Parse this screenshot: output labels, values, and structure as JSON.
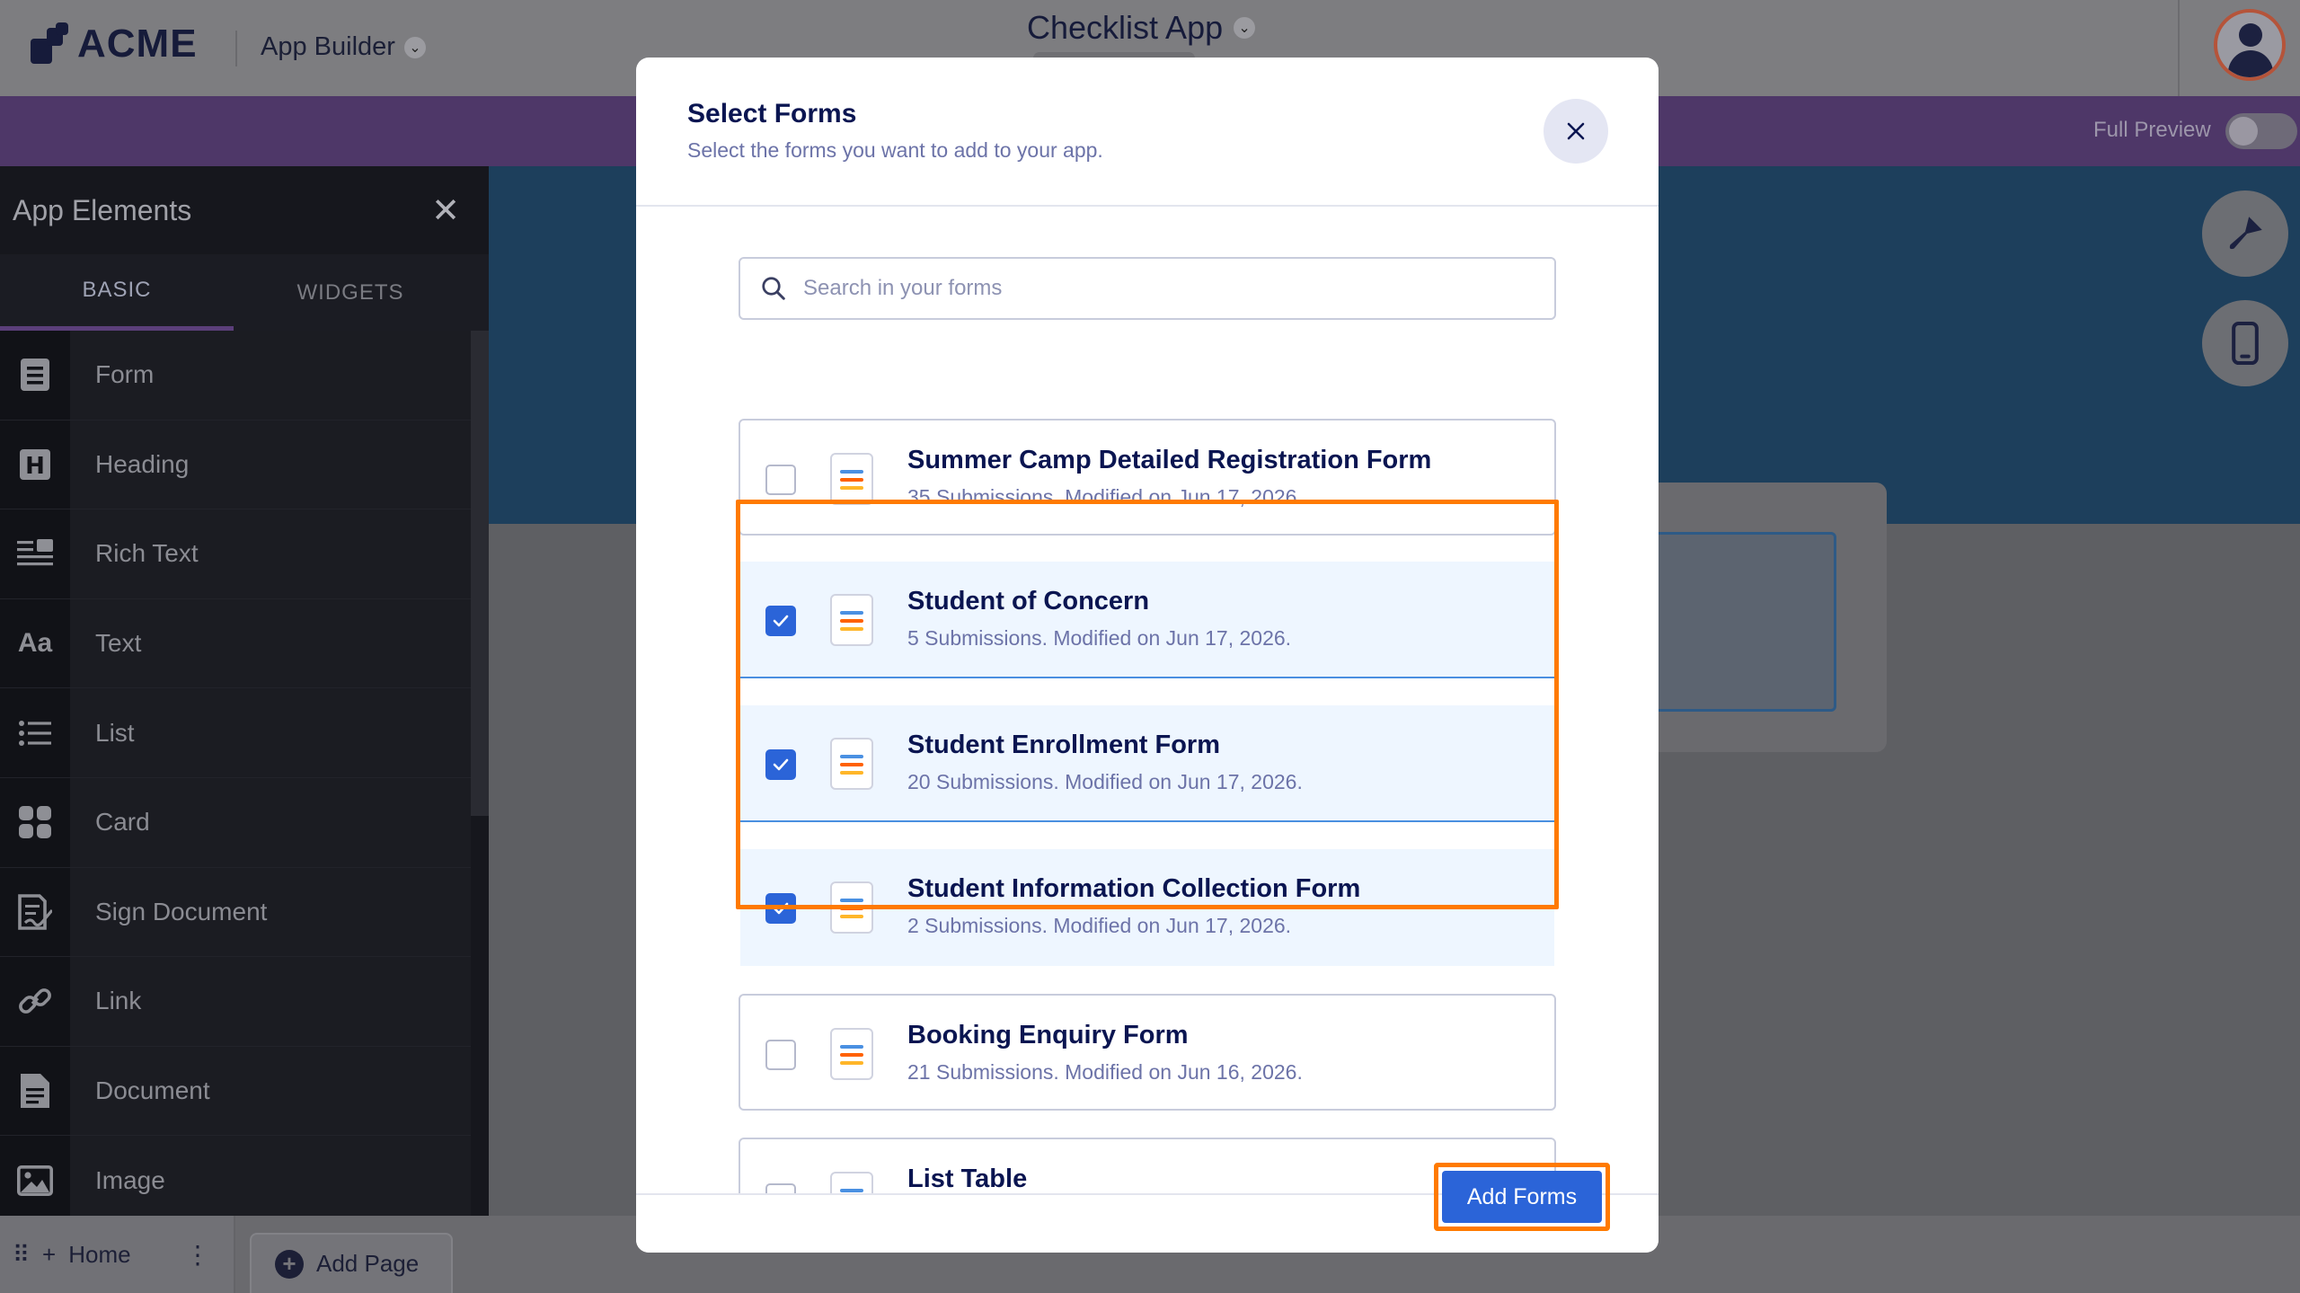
{
  "topbar": {
    "logo_text": "ACME",
    "app_builder_label": "App Builder",
    "app_title": "Checklist App"
  },
  "preview": {
    "full_preview_label": "Full Preview"
  },
  "sidebar": {
    "title": "App Elements",
    "tabs": [
      {
        "label": "BASIC",
        "active": true
      },
      {
        "label": "WIDGETS",
        "active": false
      }
    ],
    "items": [
      {
        "label": "Form",
        "icon": "form-icon"
      },
      {
        "label": "Heading",
        "icon": "heading-icon"
      },
      {
        "label": "Rich Text",
        "icon": "rich-text-icon"
      },
      {
        "label": "Text",
        "icon": "text-icon"
      },
      {
        "label": "List",
        "icon": "list-icon"
      },
      {
        "label": "Card",
        "icon": "card-icon"
      },
      {
        "label": "Sign Document",
        "icon": "sign-document-icon"
      },
      {
        "label": "Link",
        "icon": "link-icon"
      },
      {
        "label": "Document",
        "icon": "document-icon"
      },
      {
        "label": "Image",
        "icon": "image-icon"
      }
    ]
  },
  "pages": {
    "home_label": "Home",
    "add_page_label": "Add Page"
  },
  "modal": {
    "title": "Select Forms",
    "subtitle": "Select the forms you want to add to your app.",
    "search_placeholder": "Search in your forms",
    "forms": [
      {
        "title": "Summer Camp Detailed Registration Form",
        "meta": "35 Submissions. Modified on Jun 17, 2026.",
        "checked": false
      },
      {
        "title": "Student of Concern",
        "meta": "5 Submissions. Modified on Jun 17, 2026.",
        "checked": true
      },
      {
        "title": "Student Enrollment Form",
        "meta": "20 Submissions. Modified on Jun 17, 2026.",
        "checked": true
      },
      {
        "title": "Student Information Collection Form",
        "meta": "2 Submissions. Modified on Jun 17, 2026.",
        "checked": true
      },
      {
        "title": "Booking Enquiry Form",
        "meta": "21 Submissions. Modified on Jun 16, 2026.",
        "checked": false
      },
      {
        "title": "List Table",
        "meta": "",
        "checked": false
      }
    ],
    "add_button_label": "Add Forms"
  },
  "colors": {
    "accent": "#2b64d8",
    "highlight": "#ff7a00",
    "title": "#0a1551",
    "muted": "#6c73a8"
  }
}
